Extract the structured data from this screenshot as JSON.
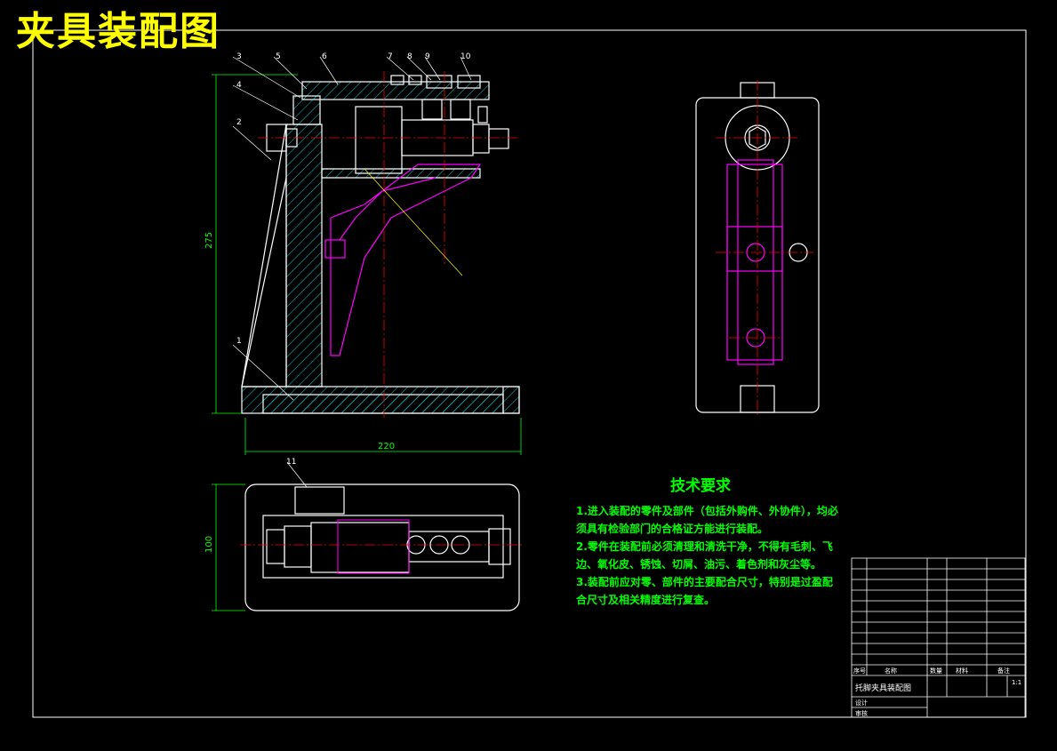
{
  "title": "夹具装配图",
  "technical_requirements": {
    "heading": "技术要求",
    "items": [
      "1.进入装配的零件及部件（包括外购件、外协件），均必须具有检验部门的合格证方能进行装配。",
      "2.零件在装配前必须清理和清洗干净，不得有毛刺、飞边、氧化皮、锈蚀、切屑、油污、着色剂和灰尘等。",
      "3.装配前应对零、部件的主要配合尺寸，特别是过盈配合尺寸及相关精度进行复查。"
    ]
  },
  "dimensions": {
    "height": "275",
    "width": "220",
    "plan_height": "100"
  },
  "balloons": [
    "1",
    "2",
    "3",
    "4",
    "5",
    "6",
    "7",
    "8",
    "9",
    "10",
    "11"
  ],
  "title_block": {
    "drawing_name": "托脚夹具装配图",
    "bom_header": [
      "序号",
      "名称",
      "数量",
      "材料",
      "备注"
    ],
    "scale": "1:1",
    "labels": [
      "设计",
      "审核"
    ]
  },
  "colors": {
    "outline": "#ffffff",
    "hatch": "#00ffff",
    "center": "#ff0000",
    "hidden": "#ff00ff",
    "dimension": "#00ff00",
    "title": "#ffff00"
  }
}
